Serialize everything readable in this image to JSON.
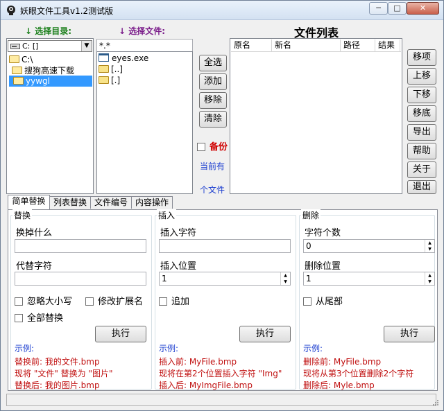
{
  "window": {
    "title": "妖眼文件工具v1.2测试版"
  },
  "titlebar": {
    "min_glyph": "─",
    "max_glyph": "□",
    "close_glyph": "✕"
  },
  "left": {
    "dir_label": "选择目录:",
    "file_label": "选择文件:",
    "drive_value": "C: []",
    "tree": [
      "C:\\",
      "搜狗高速下载",
      "yywgl"
    ],
    "file_filter": "*.*",
    "files": [
      "eyes.exe",
      "[..]",
      "[.]"
    ]
  },
  "middle": {
    "buttons": [
      "全选",
      "添加",
      "移除",
      "清除"
    ],
    "backup_label": "备份",
    "current_line1": "当前有",
    "current_line2": "个文件"
  },
  "file_list": {
    "title": "文件列表",
    "columns": [
      "原名",
      "新名",
      "路径",
      "结果"
    ]
  },
  "right_buttons": [
    "移项",
    "上移",
    "下移",
    "移底",
    "导出",
    "帮助",
    "关于",
    "退出"
  ],
  "tabs": [
    "简单替换",
    "列表替换",
    "文件编号",
    "内容操作"
  ],
  "replace": {
    "title": "替换",
    "find_label": "换掉什么",
    "find_value": "",
    "replace_label": "代替字符",
    "replace_value": "",
    "ignore_case": "忽略大小写",
    "modify_ext": "修改扩展名",
    "replace_all": "全部替换",
    "exec": "执行",
    "example_head": "示例:",
    "example": [
      "替换前: 我的文件.bmp",
      "现将 \"文件\" 替换为 \"图片\"",
      "替换后: 我的图片.bmp"
    ]
  },
  "insert": {
    "title": "插入",
    "chars_label": "插入字符",
    "chars_value": "",
    "pos_label": "插入位置",
    "pos_value": "1",
    "append": "追加",
    "exec": "执行",
    "example_head": "示例:",
    "example": [
      "插入前: MyFile.bmp",
      "现将在第2个位置插入字符 \"Img\"",
      "插入后: MyImgFile.bmp"
    ]
  },
  "delete": {
    "title": "删除",
    "count_label": "字符个数",
    "count_value": "0",
    "pos_label": "删除位置",
    "pos_value": "1",
    "from_end": "从尾部",
    "exec": "执行",
    "example_head": "示例:",
    "example": [
      "删除前: MyFile.bmp",
      "现将从第3个位置删除2个字符",
      "删除后: Myle.bmp"
    ]
  },
  "spin_glyphs": {
    "up": "▲",
    "down": "▼"
  },
  "arrow_glyph": "↓"
}
